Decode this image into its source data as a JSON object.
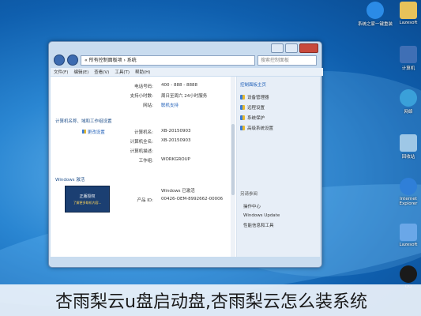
{
  "window": {
    "address": "« 所有控制面板项 › 系统",
    "search_placeholder": "搜索控制面板",
    "menu": [
      "文件(F)",
      "编辑(E)",
      "查看(V)",
      "工具(T)",
      "帮助(H)"
    ],
    "support": {
      "phone_label": "电话号码:",
      "phone_value": "400 - 888 - 8888",
      "hours_label": "支持小时数:",
      "hours_value": "周日至周六  24小时服务",
      "website_label": "网站:",
      "website_value": "联机支持"
    },
    "computer_section": "计算机名称、域和工作组设置",
    "computer": {
      "name_label": "计算机名:",
      "name_value": "XB-20150903",
      "fullname_label": "计算机全名:",
      "fullname_value": "XB-20150903",
      "desc_label": "计算机描述:",
      "workgroup_label": "工作组:",
      "workgroup_value": "WORKGROUP",
      "change_settings": "更改设置"
    },
    "activation_section": "Windows 激活",
    "activation": {
      "status_value": "Windows 已激活",
      "product_label": "产品 ID:",
      "product_value": "00426-OEM-8992662-00006"
    },
    "logo": {
      "title": "正版授权",
      "subtitle": "了解更多联机内容..."
    },
    "right_pane": {
      "heading": "控制面板主页",
      "items": [
        "设备管理器",
        "远程设置",
        "系统保护",
        "高级系统设置"
      ],
      "see_also": "另请参阅",
      "links": [
        "操作中心",
        "Windows Update",
        "性能信息和工具"
      ]
    }
  },
  "desktop_icons": [
    {
      "label": "系统之家一键重装",
      "color": "#2b8be6"
    },
    {
      "label": "Lazesoft",
      "color": "#e7c25a"
    },
    {
      "label": "计算机",
      "color": "#3f6fb5"
    },
    {
      "label": "网络",
      "color": "#3aa0d9"
    },
    {
      "label": "回收站",
      "color": "#9ec7e6"
    },
    {
      "label": "Internet Explorer",
      "color": "#2f7fd8"
    },
    {
      "label": "Lazesoft",
      "color": "#6aa7e8"
    },
    {
      "label": "QQ",
      "color": "#1a1a1a"
    }
  ],
  "caption": "杏雨梨云u盘启动盘,杏雨梨云怎么装系统"
}
